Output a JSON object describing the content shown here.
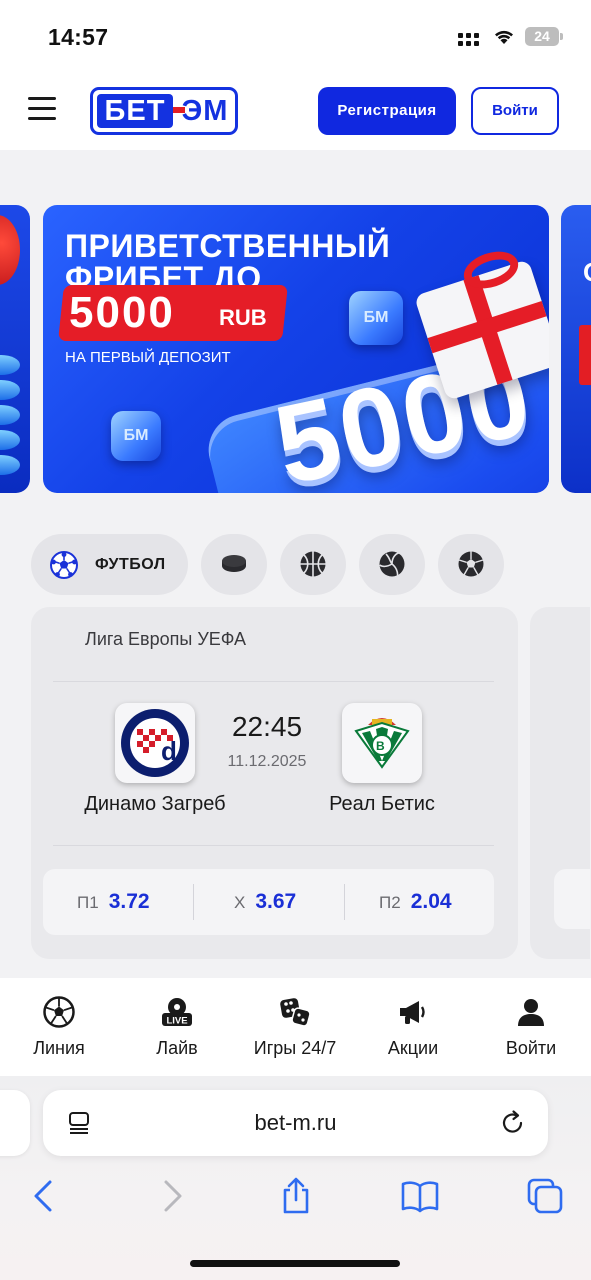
{
  "status_bar": {
    "time": "14:57",
    "battery": "24"
  },
  "header": {
    "logo_part1": "БЕТ",
    "logo_part2": "ЭМ",
    "register_label": "Регистрация",
    "login_label": "Войти"
  },
  "banner": {
    "line1": "ПРИВЕТСТВЕННЫЙ",
    "line2": "ФРИБЕТ ДО",
    "amount": "5000",
    "currency": "RUB",
    "subtitle": "НА ПЕРВЫЙ ДЕПОЗИТ",
    "big_number": "5000",
    "cube_text": "БМ"
  },
  "sports": {
    "active_label": "ФУТБОЛ",
    "items": [
      "football",
      "hockey",
      "basketball",
      "volleyball",
      "handball"
    ]
  },
  "match": {
    "league": "Лига Европы УЕФА",
    "home_team": "Динамо Загреб",
    "away_team": "Реал Бетис",
    "time": "22:45",
    "date": "11.12.2025",
    "odds": [
      {
        "key": "П1",
        "value": "3.72"
      },
      {
        "key": "X",
        "value": "3.67"
      },
      {
        "key": "П2",
        "value": "2.04"
      }
    ]
  },
  "bottom_nav": [
    {
      "label": "Линия",
      "icon": "soccer-ball-icon"
    },
    {
      "label": "Лайв",
      "icon": "live-icon"
    },
    {
      "label": "Игры 24/7",
      "icon": "dice-icon"
    },
    {
      "label": "Акции",
      "icon": "megaphone-icon"
    },
    {
      "label": "Войти",
      "icon": "user-icon"
    }
  ],
  "browser": {
    "url": "bet-m.ru"
  },
  "colors": {
    "brand_blue": "#1028e0",
    "brand_red": "#e31e24",
    "odds_blue": "#1a2fd6"
  }
}
